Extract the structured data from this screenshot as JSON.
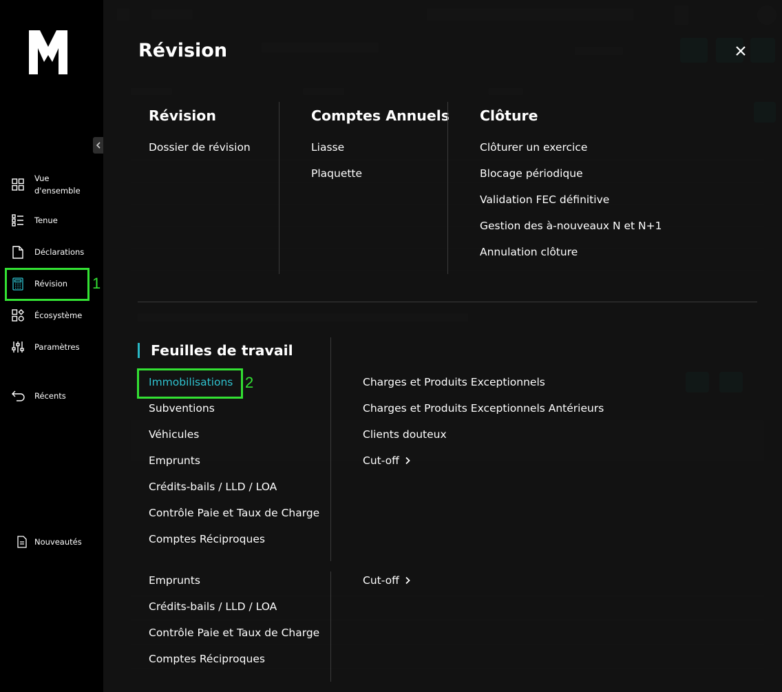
{
  "sidebar": {
    "collapse_icon": "chevron-left-icon",
    "nav": [
      {
        "label": "Vue\nd'ensemble",
        "icon": "grid-icon"
      },
      {
        "label": "Tenue",
        "icon": "list-icon"
      },
      {
        "label": "Déclarations",
        "icon": "document-icon"
      },
      {
        "label": "Révision",
        "icon": "calculator-icon"
      },
      {
        "label": "Écosystème",
        "icon": "shapes-icon"
      },
      {
        "label": "Paramètres",
        "icon": "sliders-icon"
      },
      {
        "label": "Récents",
        "icon": "back-arrow-icon"
      },
      {
        "label": "Nouveautés",
        "icon": "page-icon"
      }
    ]
  },
  "annotations": {
    "marker_1": "1",
    "marker_2": "2",
    "color": "#33e133"
  },
  "panel": {
    "title": "Révision",
    "accent_color": "#29b8c6",
    "columns": [
      {
        "heading": "Révision",
        "items": [
          "Dossier de révision"
        ]
      },
      {
        "heading": "Comptes Annuels",
        "items": [
          "Liasse",
          "Plaquette"
        ]
      },
      {
        "heading": "Clôture",
        "items": [
          "Clôturer un exercice",
          "Blocage périodique",
          "Validation FEC définitive",
          "Gestion des à-nouveaux N et N+1",
          "Annulation clôture"
        ]
      }
    ],
    "worksheets": {
      "heading": "Feuilles de travail",
      "left_items": [
        "Immobilisations",
        "Subventions",
        "Véhicules",
        "Emprunts",
        "Crédits-bails / LLD / LOA",
        "Contrôle Paie et Taux de Charge",
        "Comptes Réciproques"
      ],
      "right_items": [
        "Charges et Produits Exceptionnels",
        "Charges et Produits Exceptionnels Antérieurs",
        "Clients douteux",
        "Cut-off"
      ]
    },
    "repeat": {
      "left_items": [
        "Emprunts",
        "Crédits-bails / LLD / LOA",
        "Contrôle Paie et Taux de Charge",
        "Comptes Réciproques"
      ],
      "right_items": [
        "Cut-off"
      ]
    }
  }
}
